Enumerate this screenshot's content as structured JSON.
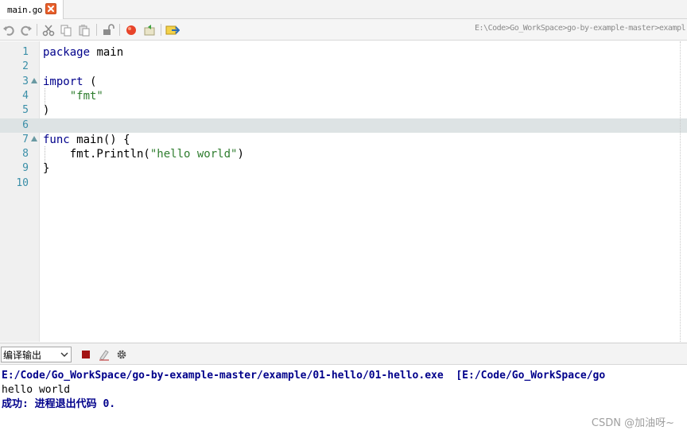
{
  "tab": {
    "label": "main.go"
  },
  "toolbar": {
    "path": "E:\\Code>Go_WorkSpace>go-by-example-master>exampl"
  },
  "editor": {
    "line_numbers": [
      "1",
      "2",
      "3",
      "4",
      "5",
      "6",
      "7",
      "8",
      "9",
      "10"
    ],
    "current_line": 6,
    "lines": [
      [
        {
          "t": "package",
          "c": "kw"
        },
        {
          "t": " main",
          "c": ""
        }
      ],
      [],
      [
        {
          "t": "import",
          "c": "kw"
        },
        {
          "t": " (",
          "c": ""
        }
      ],
      [
        {
          "t": "    ",
          "c": ""
        },
        {
          "t": "\"fmt\"",
          "c": "str"
        }
      ],
      [
        {
          "t": ")",
          "c": ""
        }
      ],
      [],
      [
        {
          "t": "func",
          "c": "kw"
        },
        {
          "t": " main() {",
          "c": ""
        }
      ],
      [
        {
          "t": "    fmt.Println(",
          "c": ""
        },
        {
          "t": "\"hello world\"",
          "c": "str"
        },
        {
          "t": ")",
          "c": ""
        }
      ],
      [
        {
          "t": "}",
          "c": ""
        }
      ],
      []
    ],
    "fold_lines": [
      3,
      7
    ]
  },
  "output_panel": {
    "selector_label": "编译输出",
    "command_line": "E:/Code/Go_WorkSpace/go-by-example-master/example/01-hello/01-hello.exe  [E:/Code/Go_WorkSpace/go",
    "program_output": "hello world",
    "status_line": "成功: 进程退出代码 0."
  },
  "watermark": "CSDN @加油呀~",
  "colors": {
    "keyword": "#00008b",
    "string": "#2e7d2e",
    "line_number": "#3b8fa8",
    "current_line_bg": "#dde3e4",
    "close_button": "#e8602c"
  },
  "icons": [
    "undo-icon",
    "redo-icon",
    "cut-icon",
    "copy-icon",
    "paste-icon",
    "lock-icon",
    "record-icon",
    "run-script-icon",
    "go-to-icon",
    "stop-icon",
    "clear-icon",
    "settings-icon",
    "close-icon",
    "chevron-down-icon"
  ]
}
